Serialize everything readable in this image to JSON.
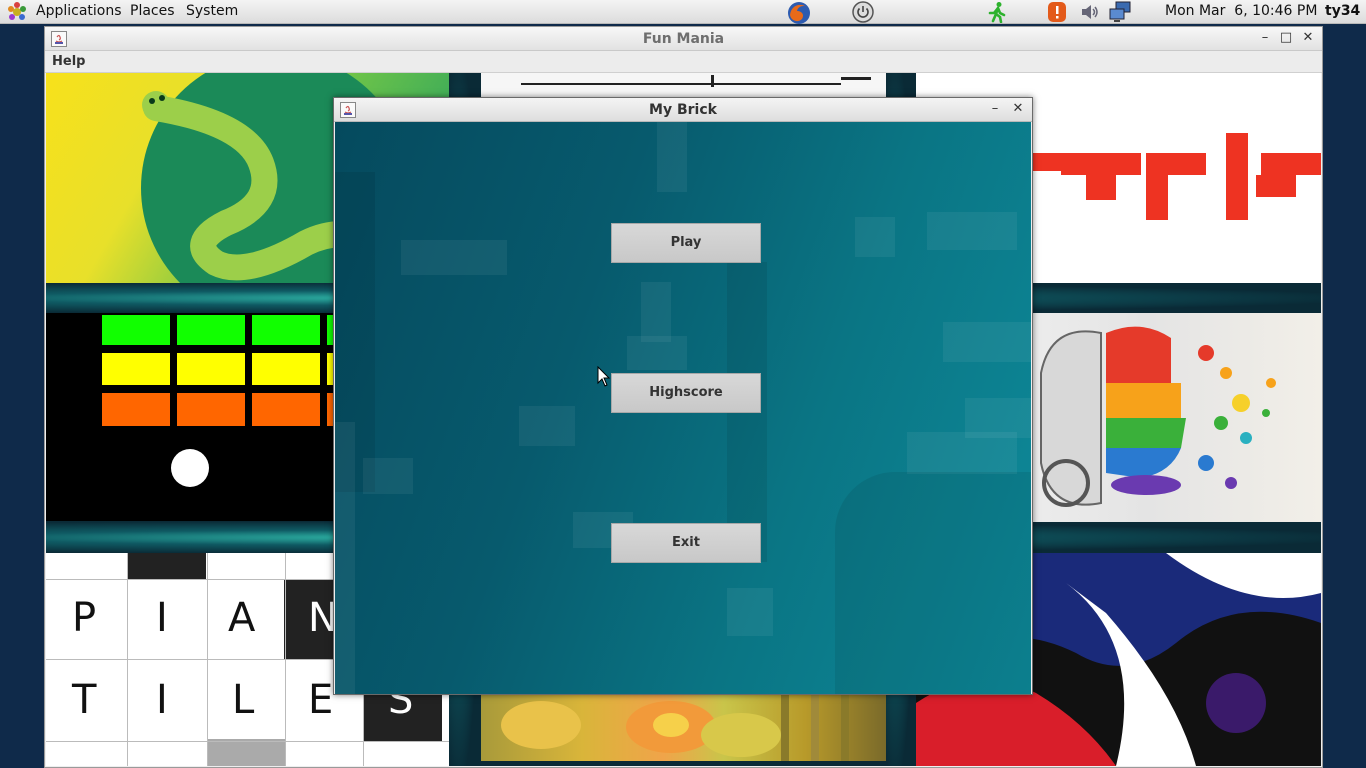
{
  "panel": {
    "menus": [
      "Applications",
      "Places",
      "System"
    ],
    "clock": "Mon Mar  6, 10:46 PM",
    "user": "ty34",
    "icons": [
      "gnome-foot-icon",
      "firefox-icon",
      "power-icon",
      "running-man-icon",
      "alert-icon",
      "volume-icon",
      "network-icon"
    ]
  },
  "fun_mania": {
    "title": "Fun Mania",
    "menu": {
      "help": "Help"
    },
    "tiles": {
      "piano_row1": [
        "P",
        "I",
        "A",
        "N"
      ],
      "piano_row2": [
        "T",
        "I",
        "L",
        "E",
        "S"
      ]
    }
  },
  "my_brick": {
    "title": "My Brick",
    "buttons": {
      "play": "Play",
      "highscore": "Highscore",
      "exit": "Exit"
    }
  },
  "colors": {
    "panel_bg": "#e6e6e6",
    "game_bg": "#07606f",
    "button_bg": "#d0d0d0",
    "brick_green": "#11ff00",
    "brick_yellow": "#ffff00",
    "brick_orange": "#ff6600",
    "tetris_red": "#ee3322"
  }
}
